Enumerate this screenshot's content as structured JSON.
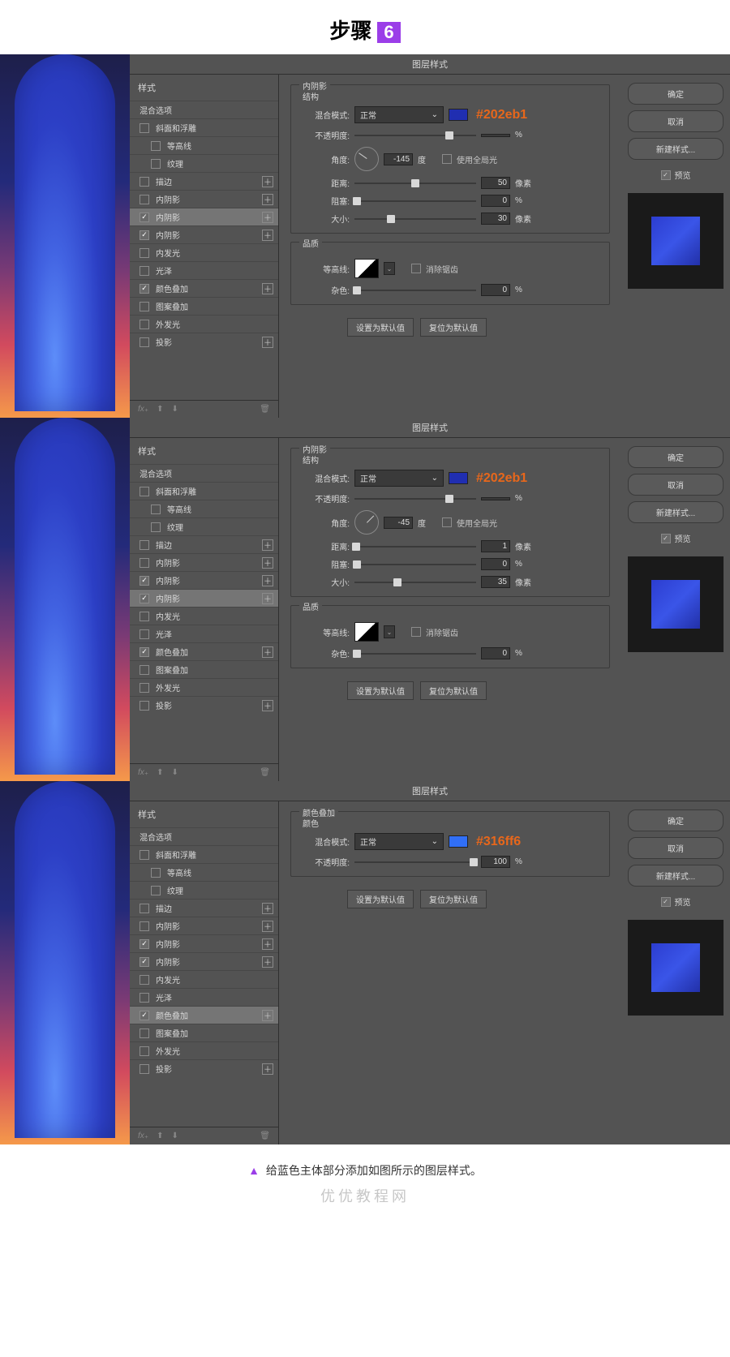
{
  "header": {
    "step": "步骤",
    "num": "6"
  },
  "dialogs": [
    {
      "title": "图层样式",
      "effect_title": "内阴影",
      "section_struct": "结构",
      "hex": "#202eb1",
      "styles_header": "样式",
      "blending_opts": "混合选项",
      "rows": [
        {
          "label": "斜面和浮雕",
          "checked": false,
          "add": false
        },
        {
          "label": "等高线",
          "checked": false,
          "add": false,
          "indent": true
        },
        {
          "label": "纹理",
          "checked": false,
          "add": false,
          "indent": true
        },
        {
          "label": "描边",
          "checked": false,
          "add": true
        },
        {
          "label": "内阴影",
          "checked": false,
          "add": true
        },
        {
          "label": "内阴影",
          "checked": true,
          "add": true,
          "selected": true
        },
        {
          "label": "内阴影",
          "checked": true,
          "add": true
        },
        {
          "label": "内发光",
          "checked": false,
          "add": false
        },
        {
          "label": "光泽",
          "checked": false,
          "add": false
        },
        {
          "label": "颜色叠加",
          "checked": true,
          "add": true
        },
        {
          "label": "图案叠加",
          "checked": false,
          "add": false
        },
        {
          "label": "外发光",
          "checked": false,
          "add": false
        },
        {
          "label": "投影",
          "checked": false,
          "add": true
        }
      ],
      "blend_label": "混合模式:",
      "blend_mode": "正常",
      "opacity_label": "不透明度:",
      "opacity": "",
      "opacity_unit": "%",
      "angle_label": "角度:",
      "angle": "-145",
      "angle_unit": "度",
      "global_light": "使用全局光",
      "distance_label": "距离:",
      "distance": "50",
      "px": "像素",
      "choke_label": "阻塞:",
      "choke": "0",
      "pct": "%",
      "size_label": "大小:",
      "size": "30",
      "quality_label": "品质",
      "contour_label": "等高线:",
      "antialias": "消除锯齿",
      "noise_label": "杂色:",
      "noise": "0",
      "set_default": "设置为默认值",
      "reset_default": "复位为默认值",
      "buttons": {
        "ok": "确定",
        "cancel": "取消",
        "new_style": "新建样式...",
        "preview": "预览"
      }
    },
    {
      "title": "图层样式",
      "effect_title": "内阴影",
      "section_struct": "结构",
      "hex": "#202eb1",
      "styles_header": "样式",
      "blending_opts": "混合选项",
      "rows": [
        {
          "label": "斜面和浮雕",
          "checked": false,
          "add": false
        },
        {
          "label": "等高线",
          "checked": false,
          "add": false,
          "indent": true
        },
        {
          "label": "纹理",
          "checked": false,
          "add": false,
          "indent": true
        },
        {
          "label": "描边",
          "checked": false,
          "add": true
        },
        {
          "label": "内阴影",
          "checked": false,
          "add": true
        },
        {
          "label": "内阴影",
          "checked": true,
          "add": true
        },
        {
          "label": "内阴影",
          "checked": true,
          "add": true,
          "selected": true
        },
        {
          "label": "内发光",
          "checked": false,
          "add": false
        },
        {
          "label": "光泽",
          "checked": false,
          "add": false
        },
        {
          "label": "颜色叠加",
          "checked": true,
          "add": true
        },
        {
          "label": "图案叠加",
          "checked": false,
          "add": false
        },
        {
          "label": "外发光",
          "checked": false,
          "add": false
        },
        {
          "label": "投影",
          "checked": false,
          "add": true
        }
      ],
      "blend_label": "混合模式:",
      "blend_mode": "正常",
      "opacity_label": "不透明度:",
      "opacity": "",
      "opacity_unit": "%",
      "angle_label": "角度:",
      "angle": "-45",
      "angle_unit": "度",
      "global_light": "使用全局光",
      "distance_label": "距离:",
      "distance": "1",
      "px": "像素",
      "choke_label": "阻塞:",
      "choke": "0",
      "pct": "%",
      "size_label": "大小:",
      "size": "35",
      "quality_label": "品质",
      "contour_label": "等高线:",
      "antialias": "消除锯齿",
      "noise_label": "杂色:",
      "noise": "0",
      "set_default": "设置为默认值",
      "reset_default": "复位为默认值",
      "buttons": {
        "ok": "确定",
        "cancel": "取消",
        "new_style": "新建样式...",
        "preview": "预览"
      }
    },
    {
      "title": "图层样式",
      "effect_title": "颜色叠加",
      "section_struct": "颜色",
      "hex": "#316ff6",
      "styles_header": "样式",
      "blending_opts": "混合选项",
      "rows": [
        {
          "label": "斜面和浮雕",
          "checked": false,
          "add": false
        },
        {
          "label": "等高线",
          "checked": false,
          "add": false,
          "indent": true
        },
        {
          "label": "纹理",
          "checked": false,
          "add": false,
          "indent": true
        },
        {
          "label": "描边",
          "checked": false,
          "add": true
        },
        {
          "label": "内阴影",
          "checked": false,
          "add": true
        },
        {
          "label": "内阴影",
          "checked": true,
          "add": true
        },
        {
          "label": "内阴影",
          "checked": true,
          "add": true
        },
        {
          "label": "内发光",
          "checked": false,
          "add": false
        },
        {
          "label": "光泽",
          "checked": false,
          "add": false
        },
        {
          "label": "颜色叠加",
          "checked": true,
          "add": true,
          "selected": true
        },
        {
          "label": "图案叠加",
          "checked": false,
          "add": false
        },
        {
          "label": "外发光",
          "checked": false,
          "add": false
        },
        {
          "label": "投影",
          "checked": false,
          "add": true
        }
      ],
      "blend_label": "混合模式:",
      "blend_mode": "正常",
      "opacity_label": "不透明度:",
      "opacity": "100",
      "opacity_unit": "%",
      "set_default": "设置为默认值",
      "reset_default": "复位为默认值",
      "buttons": {
        "ok": "确定",
        "cancel": "取消",
        "new_style": "新建样式...",
        "preview": "预览"
      }
    }
  ],
  "caption": "给蓝色主体部分添加如图所示的图层样式。",
  "watermark": "优优教程网",
  "footer_fx": "fx"
}
